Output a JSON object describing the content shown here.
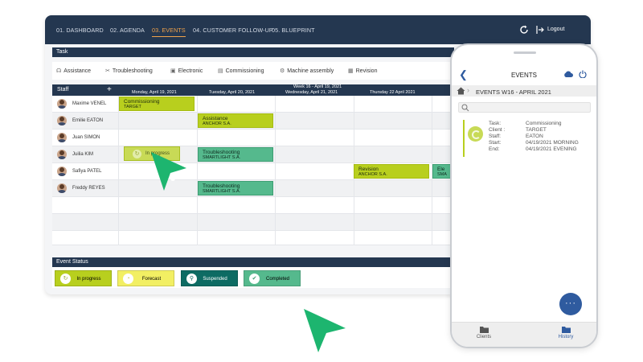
{
  "nav": {
    "tabs": [
      "01. DASHBOARD",
      "02. AGENDA",
      "03. EVENTS",
      "04. CUSTOMER FOLLOW-UP",
      "05. BLUEPRINT"
    ],
    "active_tab": "03. EVENTS",
    "logout": "Logout"
  },
  "task": {
    "title": "Task",
    "items": [
      "Assistance",
      "Troubleshooting",
      "Electronic",
      "Commissioning",
      "Machine assembly",
      "Revision"
    ]
  },
  "grid": {
    "staff_header": "Staff",
    "week_label": "Week 16 - April 19, 2021",
    "days": [
      "Monday, April 19, 2021",
      "Tuesday, April 20, 2021",
      "Wednesday, April 21, 2021",
      "Thursday 22 April 2021"
    ],
    "staff": [
      "Maxime VENEL",
      "Emilie EATON",
      "Juan SIMON",
      "Juilia KIM",
      "Safiya PATEL",
      "Freddy REYES"
    ],
    "events": [
      {
        "title": "Commissioning",
        "client": "TARGET"
      },
      {
        "title": "Assistance",
        "client": "ANCHOR S.A."
      },
      {
        "title": "Troubleshooting",
        "client": "SMARTLIGHT S.A."
      },
      {
        "title": "Revision",
        "client": "ANCHOR S.A."
      },
      {
        "title": "Ele",
        "client": "SMA"
      },
      {
        "title": "Troubleshooting",
        "client": "SMARTLIGHT S.A."
      }
    ],
    "dragging_label": "In progress"
  },
  "event_status": {
    "title": "Event Status",
    "items": [
      {
        "label": "In progress",
        "color": "#b8cf1e"
      },
      {
        "label": "Forecast",
        "color": "#f2ef63"
      },
      {
        "label": "Suspended",
        "color": "#0d6b63"
      },
      {
        "label": "Completed",
        "color": "#55b98d"
      }
    ]
  },
  "phone": {
    "title": "EVENTS",
    "crumb": "EVENTS W16 - APRIL 2021",
    "card": {
      "keys": [
        "Task:",
        "Client :",
        "Staff:",
        "Start:",
        "End:"
      ],
      "values": [
        "Commissioning",
        "TARGET",
        "EATON",
        "04/19/2021 MORNING",
        "04/19/2021 EVENING"
      ]
    },
    "fab": "···",
    "bottom": {
      "clients": "Clients",
      "history": "History"
    }
  },
  "colors": {
    "navy": "#243750",
    "accent": "#f0a24a",
    "brand_green": "#1db56f"
  }
}
